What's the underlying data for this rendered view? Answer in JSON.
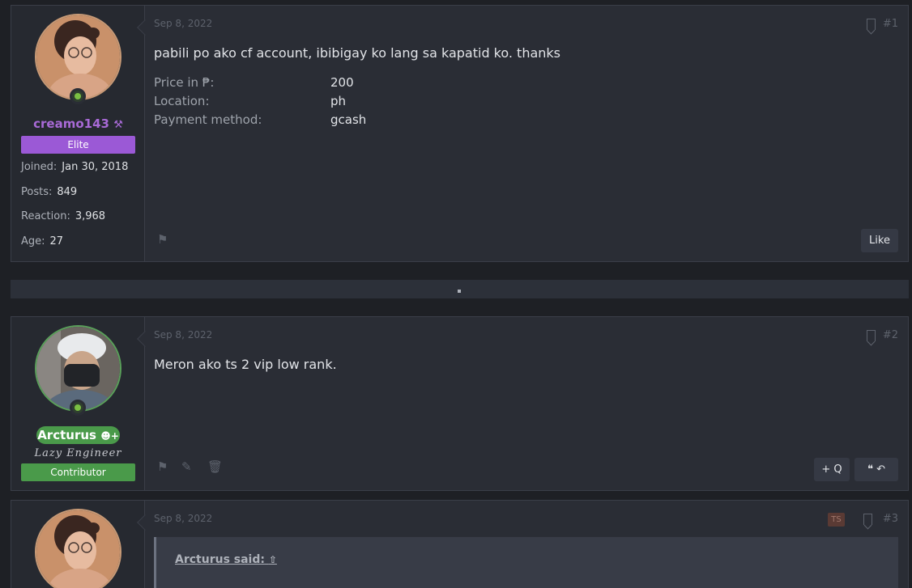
{
  "posts": [
    {
      "date": "Sep 8, 2022",
      "number": "#1",
      "user": {
        "name": "creamo143",
        "banner": "Elite",
        "banner_color": "#9b59d6",
        "name_color": "#a86ad6",
        "stats": [
          {
            "label": "Joined:",
            "value": "Jan 30, 2018"
          },
          {
            "label": "Posts:",
            "value": "849"
          },
          {
            "label": "Reaction:",
            "value": "3,968"
          },
          {
            "label": "Age:",
            "value": "27"
          }
        ]
      },
      "message": "pabili po ako cf account, ibibigay ko lang sa kapatid ko. thanks",
      "fields": [
        {
          "label": "Price in ₱:",
          "value": "200"
        },
        {
          "label": "Location:",
          "value": "ph"
        },
        {
          "label": "Payment method:",
          "value": "gcash"
        }
      ],
      "like_label": "Like"
    },
    {
      "date": "Sep 8, 2022",
      "number": "#2",
      "user": {
        "name": "Arcturus",
        "title": "Lazy Engineer",
        "banner": "Contributor",
        "banner_color": "#4a9a4a",
        "name_bg": "#4a9a4a"
      },
      "message": "Meron ako ts 2 vip low rank.",
      "multiquote_label": "+ Q"
    },
    {
      "date": "Sep 8, 2022",
      "number": "#3",
      "ts_badge": "TS",
      "quote_attribution": "Arcturus said:"
    }
  ]
}
